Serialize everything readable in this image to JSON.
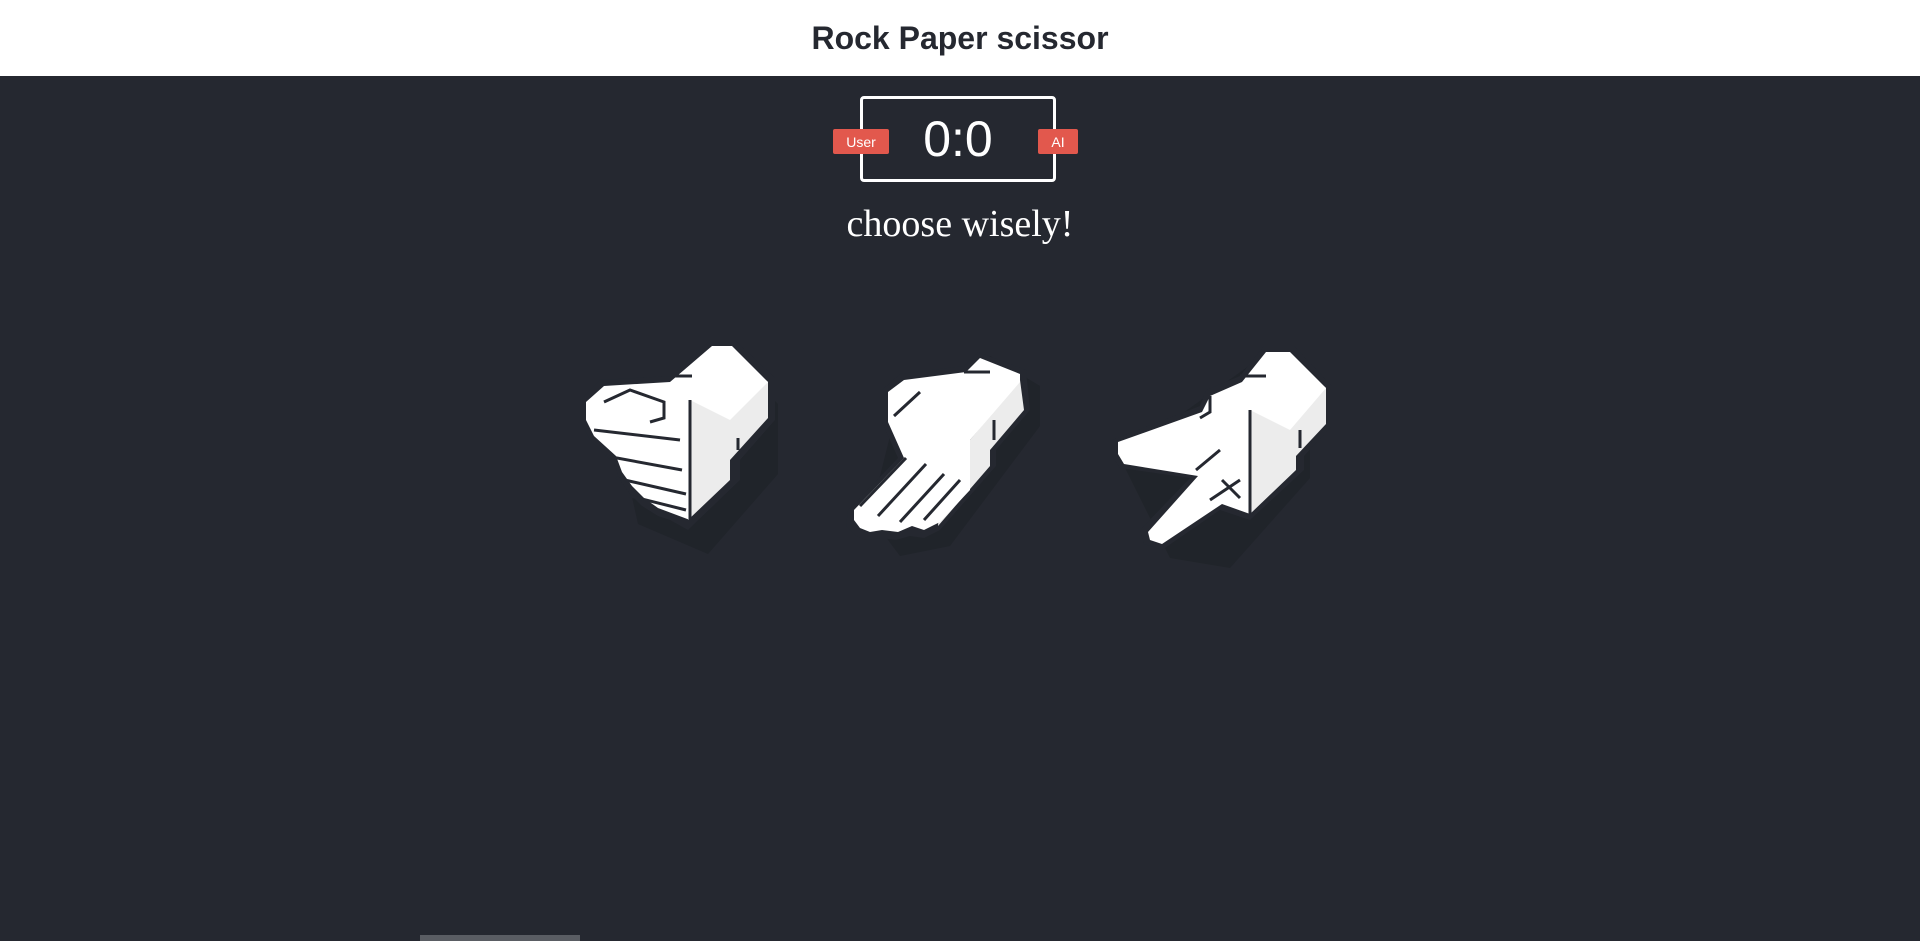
{
  "header": {
    "title": "Rock Paper scissor"
  },
  "score": {
    "display": "0:0",
    "user_label": "User",
    "ai_label": "AI"
  },
  "message": "choose wisely!",
  "choices": [
    {
      "name": "rock",
      "icon": "rock-hand-icon"
    },
    {
      "name": "paper",
      "icon": "paper-hand-icon"
    },
    {
      "name": "scissors",
      "icon": "scissors-hand-icon"
    }
  ],
  "colors": {
    "background": "#252830",
    "header_bg": "#ffffff",
    "badge": "#e2584d",
    "hand_fill": "#ffffff",
    "hand_shade": "#e8e8e8",
    "outline": "#252830"
  }
}
